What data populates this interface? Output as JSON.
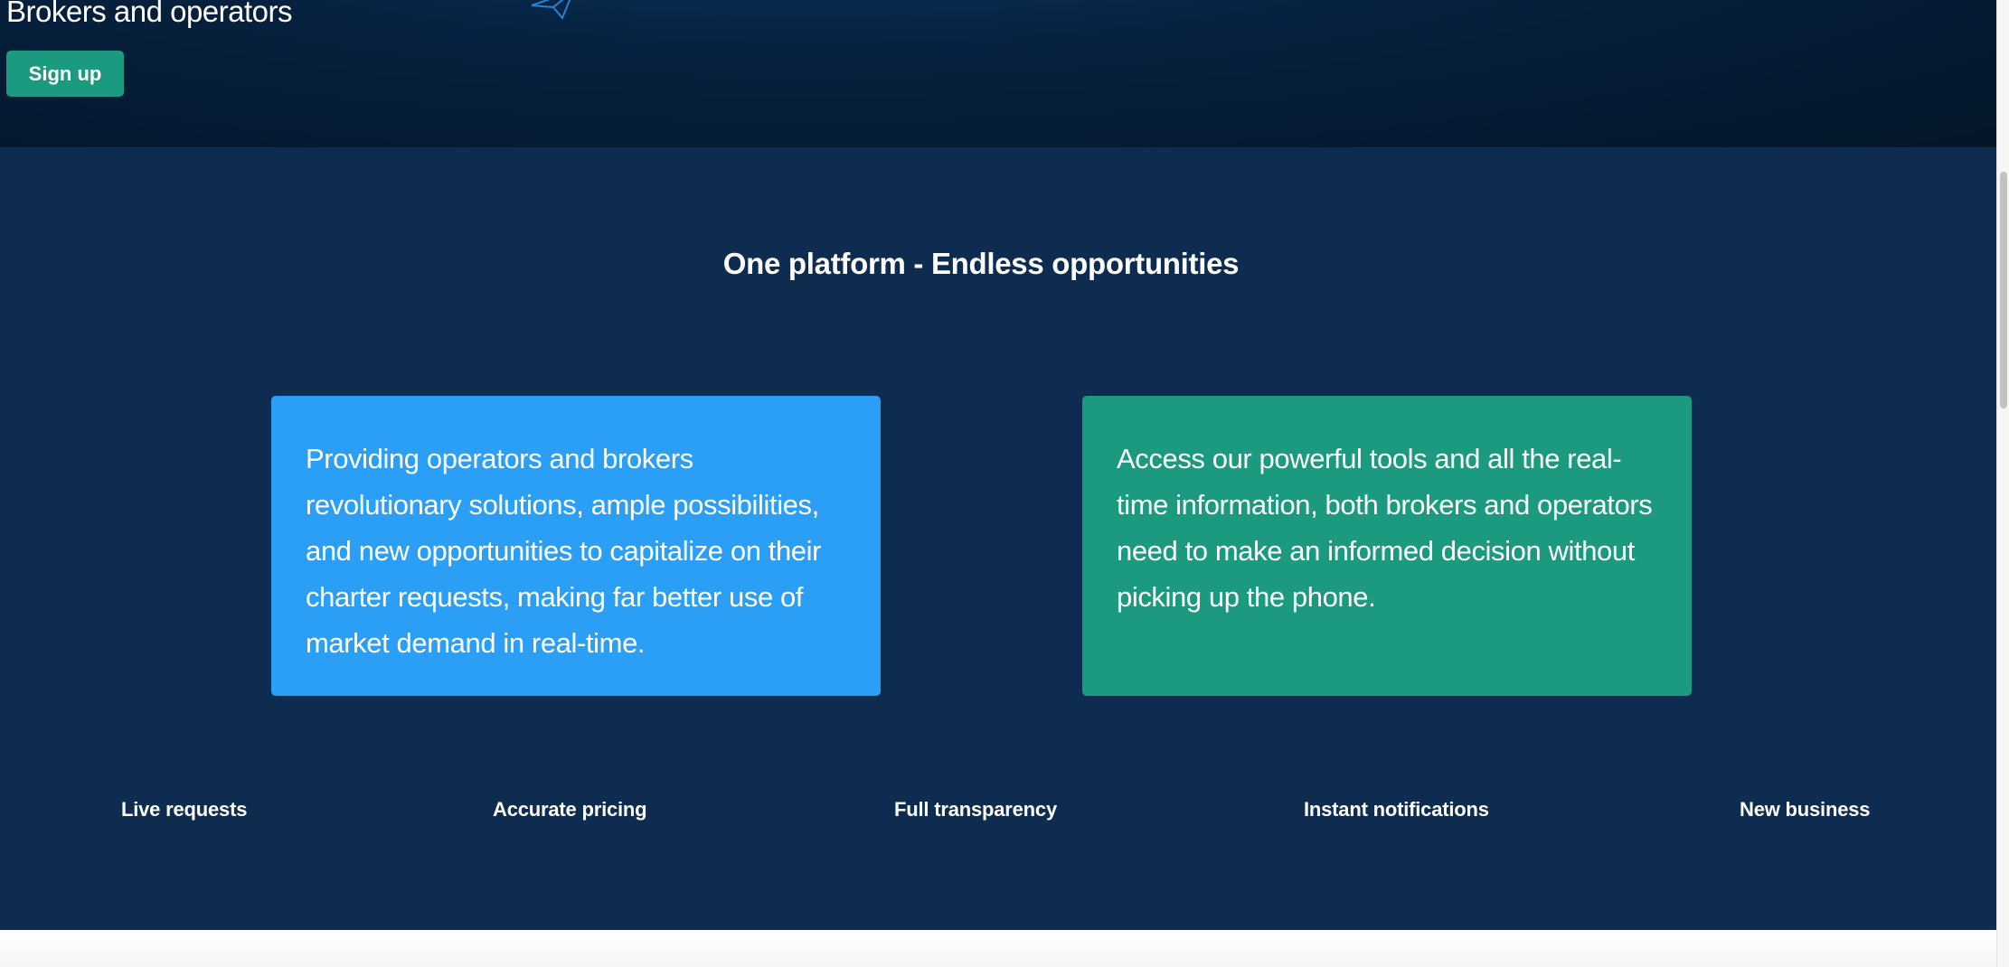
{
  "hero": {
    "subtitle": "Brokers and operators",
    "signup_label": "Sign up",
    "icon": "paper-plane-icon"
  },
  "features": {
    "title": "One platform - Endless opportunities",
    "cards": [
      {
        "text": "Providing operators and brokers revolutionary solutions, ample possibilities, and new opportunities to capitalize on their charter requests, making far better use of market demand in real-time.",
        "color": "#2b9ff5"
      },
      {
        "text": "Access our powerful tools and all the real-time information, both brokers and operators need to make an informed decision without picking up the phone.",
        "color": "#1b9a80"
      }
    ],
    "benefits": [
      "Live requests",
      "Accurate pricing",
      "Full transparency",
      "Instant notifications",
      "New business"
    ]
  },
  "colors": {
    "hero_bg": "#06213f",
    "section_bg": "#0e2c4f",
    "accent_green": "#1b9a80",
    "accent_blue": "#2b9ff5"
  }
}
